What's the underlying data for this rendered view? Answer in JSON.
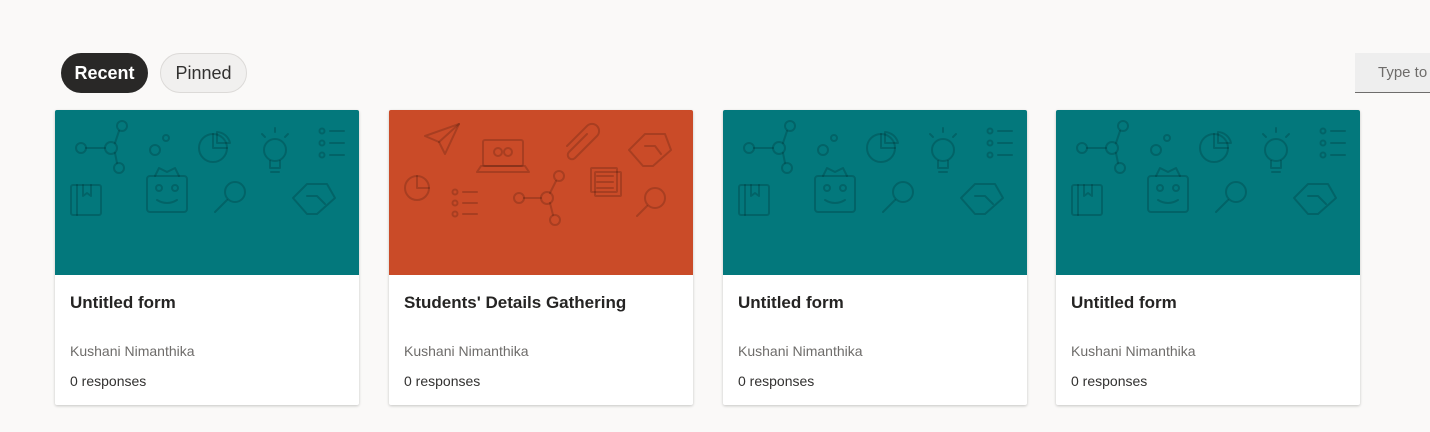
{
  "tabs": [
    {
      "label": "Recent",
      "active": true
    },
    {
      "label": "Pinned",
      "active": false
    }
  ],
  "search": {
    "placeholder": "Type to"
  },
  "colors": {
    "teal": "#03787c",
    "orange": "#ca4b28"
  },
  "cards": [
    {
      "title": "Untitled form",
      "owner": "Kushani Nimanthika",
      "responses": "0 responses",
      "banner_color": "#03787c",
      "banner_pattern": "pattern-a"
    },
    {
      "title": "Students' Details Gathering",
      "owner": "Kushani Nimanthika",
      "responses": "0 responses",
      "banner_color": "#ca4b28",
      "banner_pattern": "pattern-b"
    },
    {
      "title": "Untitled form",
      "owner": "Kushani Nimanthika",
      "responses": "0 responses",
      "banner_color": "#03787c",
      "banner_pattern": "pattern-a"
    },
    {
      "title": "Untitled form",
      "owner": "Kushani Nimanthika",
      "responses": "0 responses",
      "banner_color": "#03787c",
      "banner_pattern": "pattern-a"
    }
  ]
}
